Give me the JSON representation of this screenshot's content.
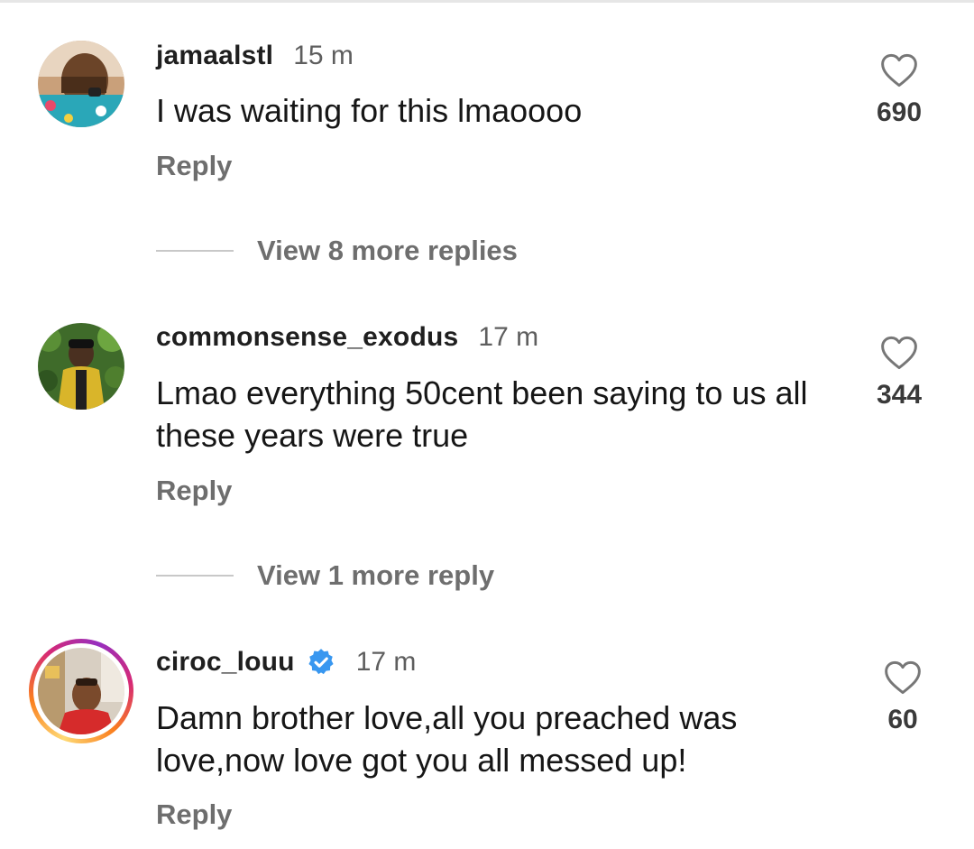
{
  "comments": [
    {
      "username": "jamaalstl",
      "time": "15 m",
      "text": "I was waiting for this lmaoooo",
      "likes": "690",
      "reply_label": "Reply",
      "verified": false,
      "story_ring": false
    },
    {
      "username": "commonsense_exodus",
      "time": "17 m",
      "text": "Lmao everything 50cent been saying to us all these years were true",
      "likes": "344",
      "reply_label": "Reply",
      "verified": false,
      "story_ring": false
    },
    {
      "username": "ciroc_louu",
      "time": "17 m",
      "text": "Damn brother love,all you preached was love,now love got you all messed up!",
      "likes": "60",
      "reply_label": "Reply",
      "verified": true,
      "story_ring": true
    }
  ],
  "view_replies": [
    {
      "label": "View 8 more replies"
    },
    {
      "label": "View 1 more reply"
    }
  ],
  "colors": {
    "verified_badge": "#3897f0",
    "secondary_text": "#6e6e6e",
    "story_ring_start": "#feda75",
    "story_ring_end": "#d62976"
  },
  "icons": {
    "like": "heart-outline-icon",
    "verified": "verified-badge-icon"
  }
}
